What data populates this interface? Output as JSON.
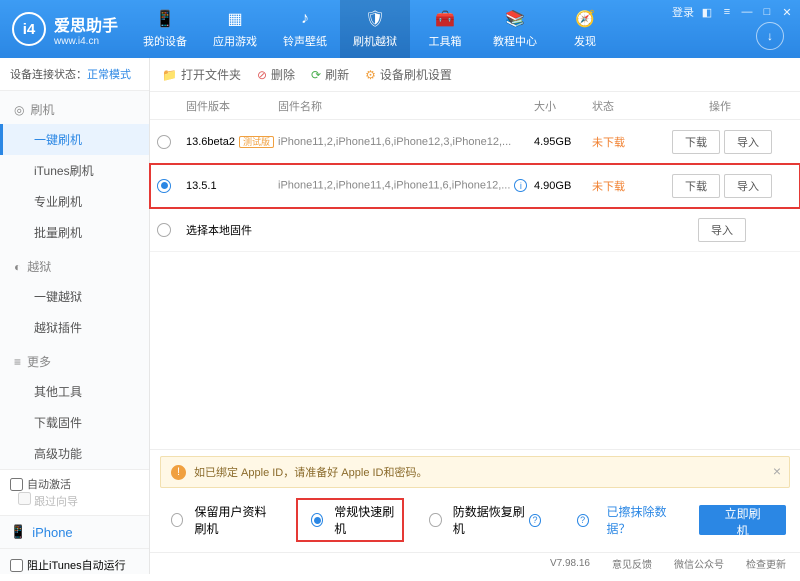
{
  "brand": {
    "name": "爱思助手",
    "url": "www.i4.cn"
  },
  "top_login": "登录",
  "nav": [
    {
      "label": "我的设备",
      "icon": "📱"
    },
    {
      "label": "应用游戏",
      "icon": "▦"
    },
    {
      "label": "铃声壁纸",
      "icon": "♪"
    },
    {
      "label": "刷机越狱",
      "icon": "🛡",
      "active": true
    },
    {
      "label": "工具箱",
      "icon": "🧰"
    },
    {
      "label": "教程中心",
      "icon": "📚"
    },
    {
      "label": "发现",
      "icon": "🧭"
    }
  ],
  "status": {
    "label": "设备连接状态：",
    "value": "正常模式"
  },
  "side": {
    "sec1": "刷机",
    "items1": [
      "一键刷机",
      "iTunes刷机",
      "专业刷机",
      "批量刷机"
    ],
    "sec2": "越狱",
    "items2": [
      "一键越狱",
      "越狱插件"
    ],
    "sec3": "更多",
    "items3": [
      "其他工具",
      "下载固件",
      "高级功能"
    ]
  },
  "side_bottom": {
    "auto_activate": "自动激活",
    "follow_guide": "跟过向导",
    "iphone": "iPhone",
    "block_itunes": "阻止iTunes自动运行"
  },
  "toolbar": {
    "open": "打开文件夹",
    "delete": "删除",
    "refresh": "刷新",
    "settings": "设备刷机设置"
  },
  "columns": {
    "version": "固件版本",
    "name": "固件名称",
    "size": "大小",
    "status": "状态",
    "action": "操作"
  },
  "rows": [
    {
      "version": "13.6beta2",
      "badge": "测试版",
      "name": "iPhone11,2,iPhone11,6,iPhone12,3,iPhone12,...",
      "size": "4.95GB",
      "status": "未下载",
      "selected": false,
      "info": false
    },
    {
      "version": "13.5.1",
      "badge": "",
      "name": "iPhone11,2,iPhone11,4,iPhone11,6,iPhone12,...",
      "size": "4.90GB",
      "status": "未下载",
      "selected": true,
      "info": true
    }
  ],
  "local_firmware": "选择本地固件",
  "btn_download": "下载",
  "btn_import": "导入",
  "warn": "如已绑定 Apple ID，请准备好 Apple ID和密码。",
  "modes": {
    "keep": "保留用户资料刷机",
    "quick": "常规快速刷机",
    "recover": "防数据恢复刷机"
  },
  "erase_link": "已擦抹除数据？",
  "flash_btn": "立即刷机",
  "footer": {
    "version": "V7.98.16",
    "feedback": "意见反馈",
    "wechat": "微信公众号",
    "update": "检查更新"
  }
}
